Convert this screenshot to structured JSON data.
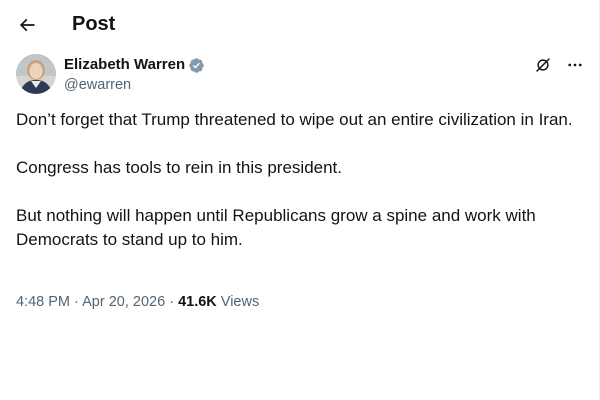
{
  "header": {
    "back_icon": "arrow-left-icon",
    "title": "Post"
  },
  "author": {
    "display_name": "Elizabeth Warren",
    "handle": "@ewarren",
    "verified_icon": "verified-badge-icon",
    "verified_color": "#829aab"
  },
  "actions": {
    "grok_icon": "grok-icon",
    "more_icon": "more-dots-icon"
  },
  "tweet": {
    "paragraphs": [
      "Don’t forget that Trump threatened to wipe out an entire civilization in Iran.",
      "Congress has tools to rein in this president.",
      "But nothing will happen until Republicans grow a spine and work with Democrats to stand up to him."
    ]
  },
  "meta": {
    "time": "4:48 PM",
    "separator": "·",
    "date": "Apr 20, 2026",
    "views_count": "41.6K",
    "views_label": "Views"
  },
  "colors": {
    "text_primary": "#0f1419",
    "text_secondary": "#536471",
    "border": "#eff3f4"
  }
}
